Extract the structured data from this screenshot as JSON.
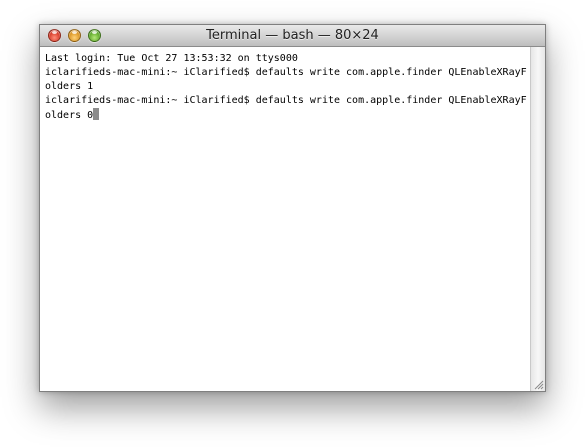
{
  "window": {
    "title": "Terminal — bash — 80×24"
  },
  "terminal": {
    "lines": [
      "Last login: Tue Oct 27 13:53:32 on ttys000",
      "iclarifieds-mac-mini:~ iClarified$ defaults write com.apple.finder QLEnableXRayF",
      "olders 1",
      "iclarifieds-mac-mini:~ iClarified$ defaults write com.apple.finder QLEnableXRayF",
      "olders 0"
    ]
  },
  "icons": {
    "close": "close-button-red",
    "minimize": "minimize-button-yellow",
    "zoom": "zoom-button-green",
    "resize": "resize-grip"
  },
  "colors": {
    "close": "#d02c1a",
    "minimize": "#d48a13",
    "zoom": "#4f9d1c",
    "cursor": "#8c8c8c"
  }
}
